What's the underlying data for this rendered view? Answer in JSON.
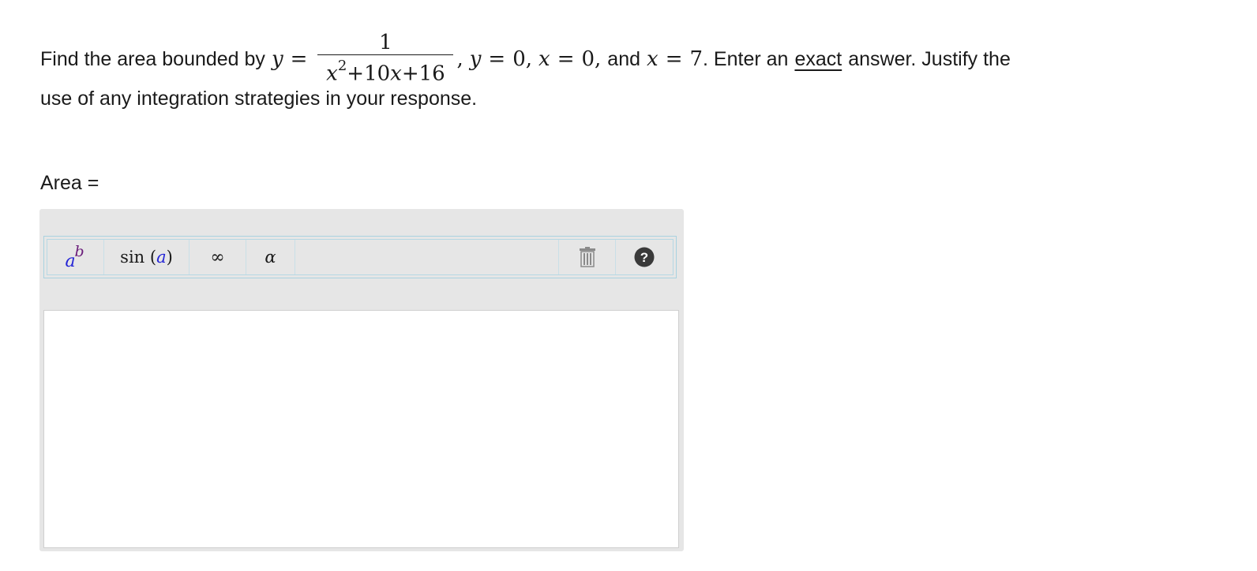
{
  "question": {
    "lead": "Find the area bounded by",
    "y_var": "y",
    "eq": "=",
    "frac_num": "1",
    "frac_den_a": "x",
    "frac_den_exp": "2",
    "frac_den_b": "+10",
    "frac_den_c": "x",
    "frac_den_d": "+16",
    "comma": ",",
    "cond1_var": "y",
    "cond1_val": "0,",
    "cond2_var": "x",
    "cond2_val": "0,",
    "and_text": "and",
    "cond3_var": "x",
    "cond3_val": "7",
    "after_cond": ". Enter an",
    "emph": "exact",
    "rest_line1": "answer. Justify the",
    "line2": "use of any integration strategies in your response."
  },
  "answer": {
    "label": "Area ="
  },
  "toolbar": {
    "power_base": "a",
    "power_exp": "b",
    "sin_fn": "sin",
    "sin_open": "(",
    "sin_var": "a",
    "sin_close": ")",
    "infinity": "∞",
    "alpha": "α",
    "trash_icon": "trash-icon",
    "help_icon": "help-icon"
  },
  "colors": {
    "toolbar_bg": "#e6e6e6",
    "toolbar_border": "#a9d2e0",
    "var_blue": "#2424d6",
    "var_purple": "#6b1d7a",
    "help_circle": "#3a3a3a"
  }
}
